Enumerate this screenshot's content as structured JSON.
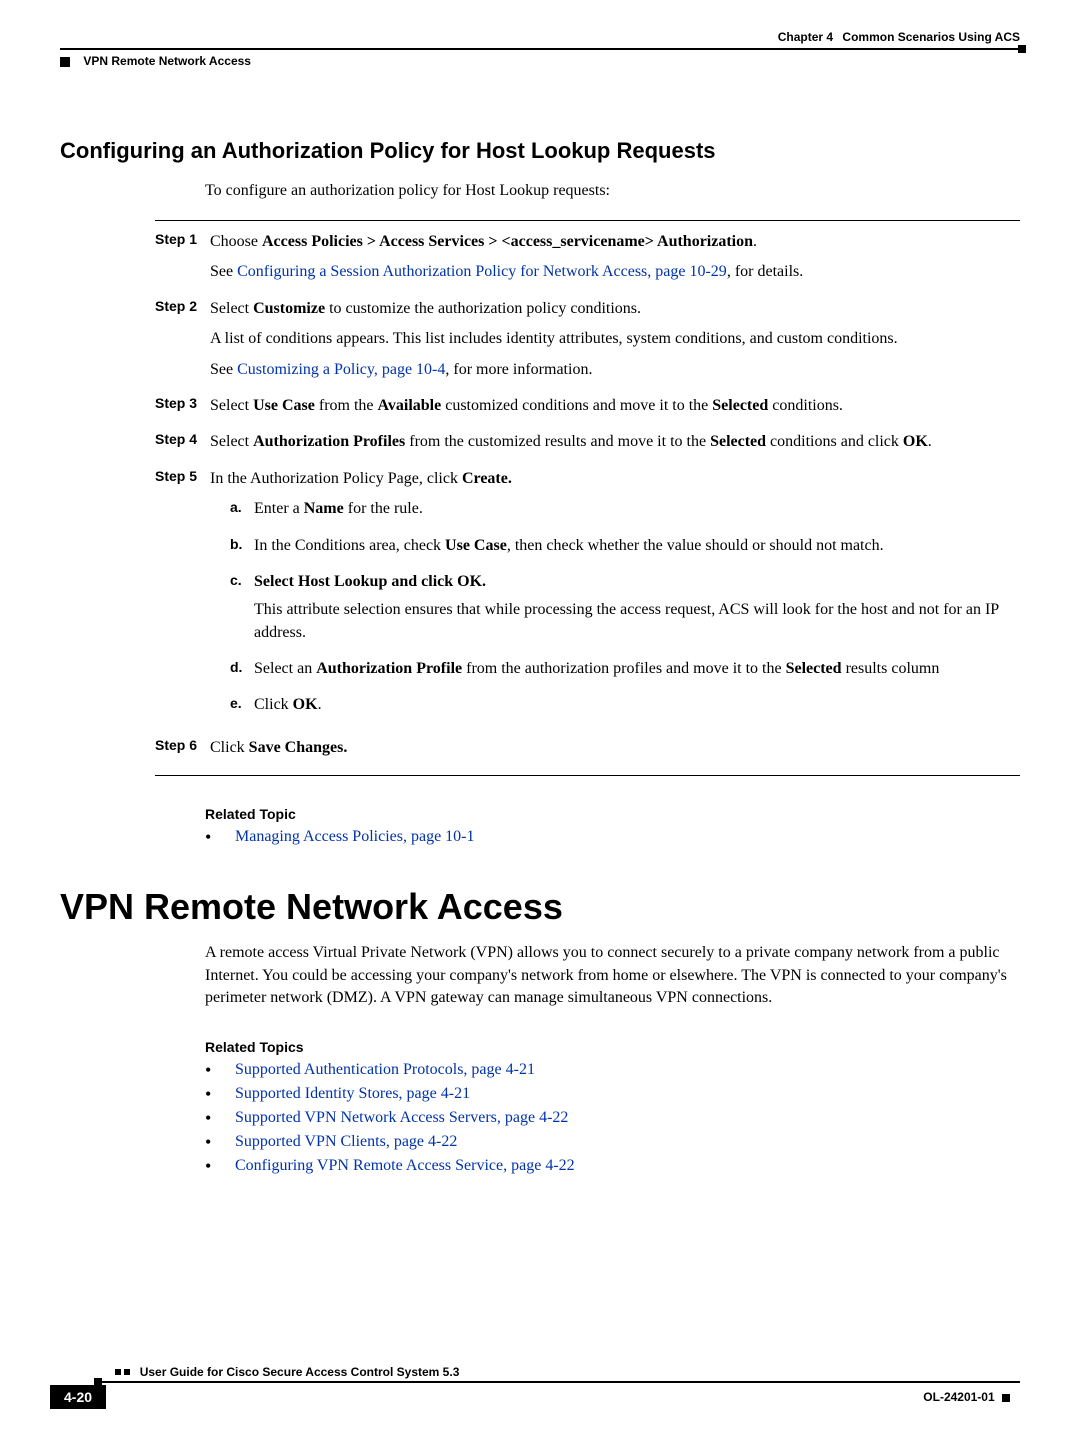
{
  "header": {
    "chapter_label": "Chapter 4",
    "chapter_title": "Common Scenarios Using ACS",
    "section_path": "VPN Remote Network Access"
  },
  "section1": {
    "title": "Configuring an Authorization Policy for Host Lookup Requests",
    "intro": "To configure an authorization policy for Host Lookup requests:"
  },
  "steps": [
    {
      "label": "Step 1",
      "parts": [
        {
          "type": "mixed",
          "pre": "Choose ",
          "bold": "Access Policies > Access Services > <access_servicename> Authorization",
          "post": "."
        },
        {
          "type": "linkpara",
          "pre": "See ",
          "link": "Configuring a Session Authorization Policy for Network Access, page 10-29",
          "post": ", for details."
        }
      ]
    },
    {
      "label": "Step 2",
      "parts": [
        {
          "type": "mixed",
          "pre": "Select ",
          "bold": "Customize",
          "post": " to customize the authorization policy conditions."
        },
        {
          "type": "plain",
          "text": "A list of conditions appears. This list includes identity attributes, system conditions, and custom conditions."
        },
        {
          "type": "linkpara",
          "pre": "See ",
          "link": "Customizing a Policy, page 10-4",
          "post": ", for more information."
        }
      ]
    },
    {
      "label": "Step 3",
      "parts": [
        {
          "type": "multi",
          "segments": [
            {
              "t": "Select "
            },
            {
              "b": "Use Case"
            },
            {
              "t": " from the "
            },
            {
              "b": "Available"
            },
            {
              "t": " customized conditions and move it to the "
            },
            {
              "b": "Selected"
            },
            {
              "t": " conditions."
            }
          ]
        }
      ]
    },
    {
      "label": "Step 4",
      "parts": [
        {
          "type": "multi",
          "segments": [
            {
              "t": "Select "
            },
            {
              "b": "Authorization Profiles"
            },
            {
              "t": " from the customized results and move it to the "
            },
            {
              "b": "Selected"
            },
            {
              "t": " conditions and click "
            },
            {
              "b": "OK"
            },
            {
              "t": "."
            }
          ]
        }
      ]
    },
    {
      "label": "Step 5",
      "parts": [
        {
          "type": "mixed",
          "pre": "In the Authorization Policy Page, click ",
          "bold": "Create.",
          "post": ""
        }
      ],
      "subs": [
        {
          "label": "a.",
          "segments": [
            {
              "t": "Enter a "
            },
            {
              "b": "Name"
            },
            {
              "t": " for the rule."
            }
          ]
        },
        {
          "label": "b.",
          "segments": [
            {
              "t": "In the Conditions area, check "
            },
            {
              "b": "Use Case"
            },
            {
              "t": ", then check whether the value should or should not match."
            }
          ]
        },
        {
          "label": "c.",
          "bold_line": "Select Host Lookup and click OK.",
          "extra": "This attribute selection ensures that while processing the access request, ACS will look for the host and not for an IP address."
        },
        {
          "label": "d.",
          "segments": [
            {
              "t": "Select an "
            },
            {
              "b": "Authorization Profile"
            },
            {
              "t": " from the authorization profiles and move it to the "
            },
            {
              "b": "Selected"
            },
            {
              "t": " results column"
            }
          ]
        },
        {
          "label": "e.",
          "segments": [
            {
              "t": "Click "
            },
            {
              "b": "OK"
            },
            {
              "t": "."
            }
          ]
        }
      ]
    },
    {
      "label": "Step 6",
      "parts": [
        {
          "type": "mixed",
          "pre": "Click ",
          "bold": "Save Changes.",
          "post": ""
        }
      ]
    }
  ],
  "related1": {
    "heading": "Related Topic",
    "items": [
      {
        "link": "Managing Access Policies, page 10-1"
      }
    ]
  },
  "section2": {
    "title": "VPN Remote Network Access",
    "para": "A remote access Virtual Private Network (VPN) allows you to connect securely to a private company network from a public Internet. You could be accessing your company's network from home or elsewhere. The VPN is connected to your company's perimeter network (DMZ). A VPN gateway can manage simultaneous VPN connections."
  },
  "related2": {
    "heading": "Related Topics",
    "items": [
      {
        "link": "Supported Authentication Protocols, page 4-21"
      },
      {
        "link": "Supported Identity Stores, page 4-21"
      },
      {
        "link": "Supported VPN Network Access Servers, page 4-22"
      },
      {
        "link": "Supported VPN Clients, page 4-22"
      },
      {
        "link": "Configuring VPN Remote Access Service, page 4-22"
      }
    ]
  },
  "footer": {
    "book_title": "User Guide for Cisco Secure Access Control System 5.3",
    "page_num": "4-20",
    "doc_id": "OL-24201-01"
  }
}
